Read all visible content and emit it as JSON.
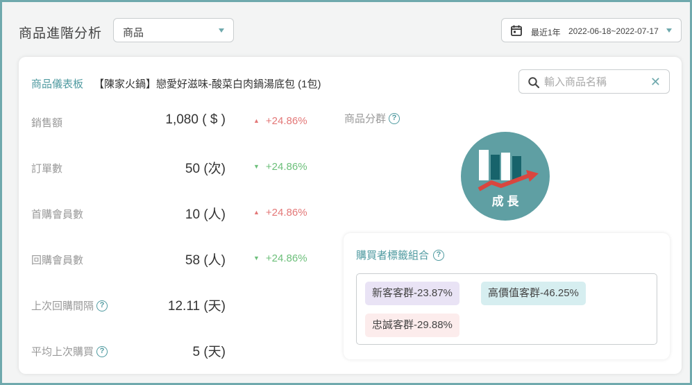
{
  "header": {
    "title": "商品進階分析",
    "type_select": {
      "value": "商品"
    },
    "date_picker": {
      "label": "最近1年",
      "range": "2022-06-18~2022-07-17"
    }
  },
  "dashboard": {
    "label": "商品儀表板",
    "product_name": "【陳家火鍋】戀愛好滋味-酸菜白肉鍋湯底包 (1包)",
    "search": {
      "placeholder": "輸入商品名稱",
      "value": "",
      "clear_symbol": "✕"
    },
    "metrics": [
      {
        "label": "銷售額",
        "value": "1,080 ( $ )",
        "delta": "+24.86%",
        "direction": "up",
        "has_help": false
      },
      {
        "label": "訂單數",
        "value": "50 (次)",
        "delta": "+24.86%",
        "direction": "down",
        "has_help": false
      },
      {
        "label": "首購會員數",
        "value": "10 (人)",
        "delta": "+24.86%",
        "direction": "up",
        "has_help": false
      },
      {
        "label": "回購會員數",
        "value": "58 (人)",
        "delta": "+24.86%",
        "direction": "down",
        "has_help": false
      },
      {
        "label": "上次回購間隔",
        "value": "12.11 (天)",
        "delta": "",
        "direction": "",
        "has_help": true
      },
      {
        "label": "平均上次購買",
        "value": "5 (天)",
        "delta": "",
        "direction": "",
        "has_help": true
      }
    ],
    "segment": {
      "label": "商品分群",
      "badge_text": "成 長",
      "icon": "growth-chart-icon"
    },
    "tag_combo": {
      "title": "購買者標籤組合",
      "chips": [
        {
          "label": "新客客群-23.87%",
          "color": "#e9e3f5"
        },
        {
          "label": "高價值客群-46.25%",
          "color": "#d6eef0"
        },
        {
          "label": "忠誠客群-29.88%",
          "color": "#fcecec"
        }
      ]
    }
  },
  "colors": {
    "accent": "#4f9aa0",
    "frame": "#6fa9ad",
    "up": "#e37777",
    "down": "#6cbf7a",
    "badge": "#5f9fa3",
    "badge_arrow": "#d9463f"
  },
  "icons": {
    "help": "?",
    "up_arrow": "▲",
    "down_arrow": "▼"
  }
}
